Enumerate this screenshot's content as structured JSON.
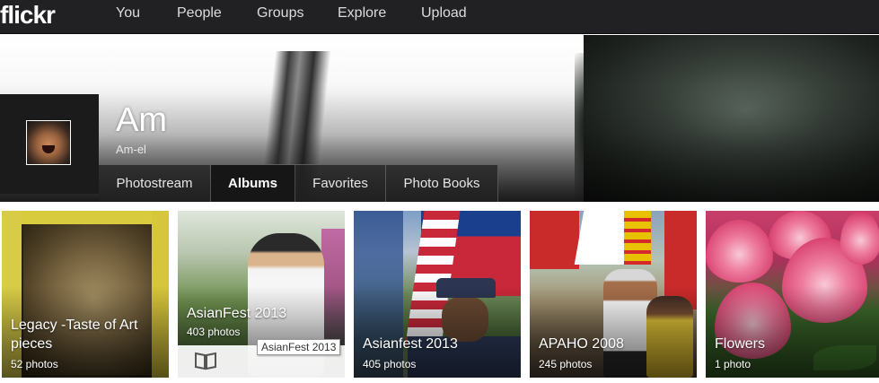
{
  "brand": {
    "logo": "flickr"
  },
  "nav": {
    "items": [
      {
        "label": "You"
      },
      {
        "label": "People"
      },
      {
        "label": "Groups"
      },
      {
        "label": "Explore"
      },
      {
        "label": "Upload"
      }
    ]
  },
  "profile": {
    "name": "Am",
    "username": "Am-el"
  },
  "subnav": {
    "tabs": [
      {
        "label": "Photostream",
        "active": false
      },
      {
        "label": "Albums",
        "active": true
      },
      {
        "label": "Favorites",
        "active": false
      },
      {
        "label": "Photo Books",
        "active": false
      }
    ]
  },
  "albums": [
    {
      "title_line1": "Legacy -Taste of Art",
      "title_line2": "pieces",
      "count": "52 photos"
    },
    {
      "title_line1": "AsianFest 2013",
      "count": "403 photos",
      "tooltip": "AsianFest 2013",
      "action_icon": "book-icon"
    },
    {
      "title_line1": "Asianfest 2013",
      "count": "405 photos"
    },
    {
      "title_line1": "APAHO 2008",
      "count": "245 photos"
    },
    {
      "title_line1": "Flowers",
      "count": "1 photo"
    }
  ],
  "colors": {
    "nav_bg": "#212124",
    "subnav_active": "#161616",
    "page_bg": "#ffffff"
  }
}
